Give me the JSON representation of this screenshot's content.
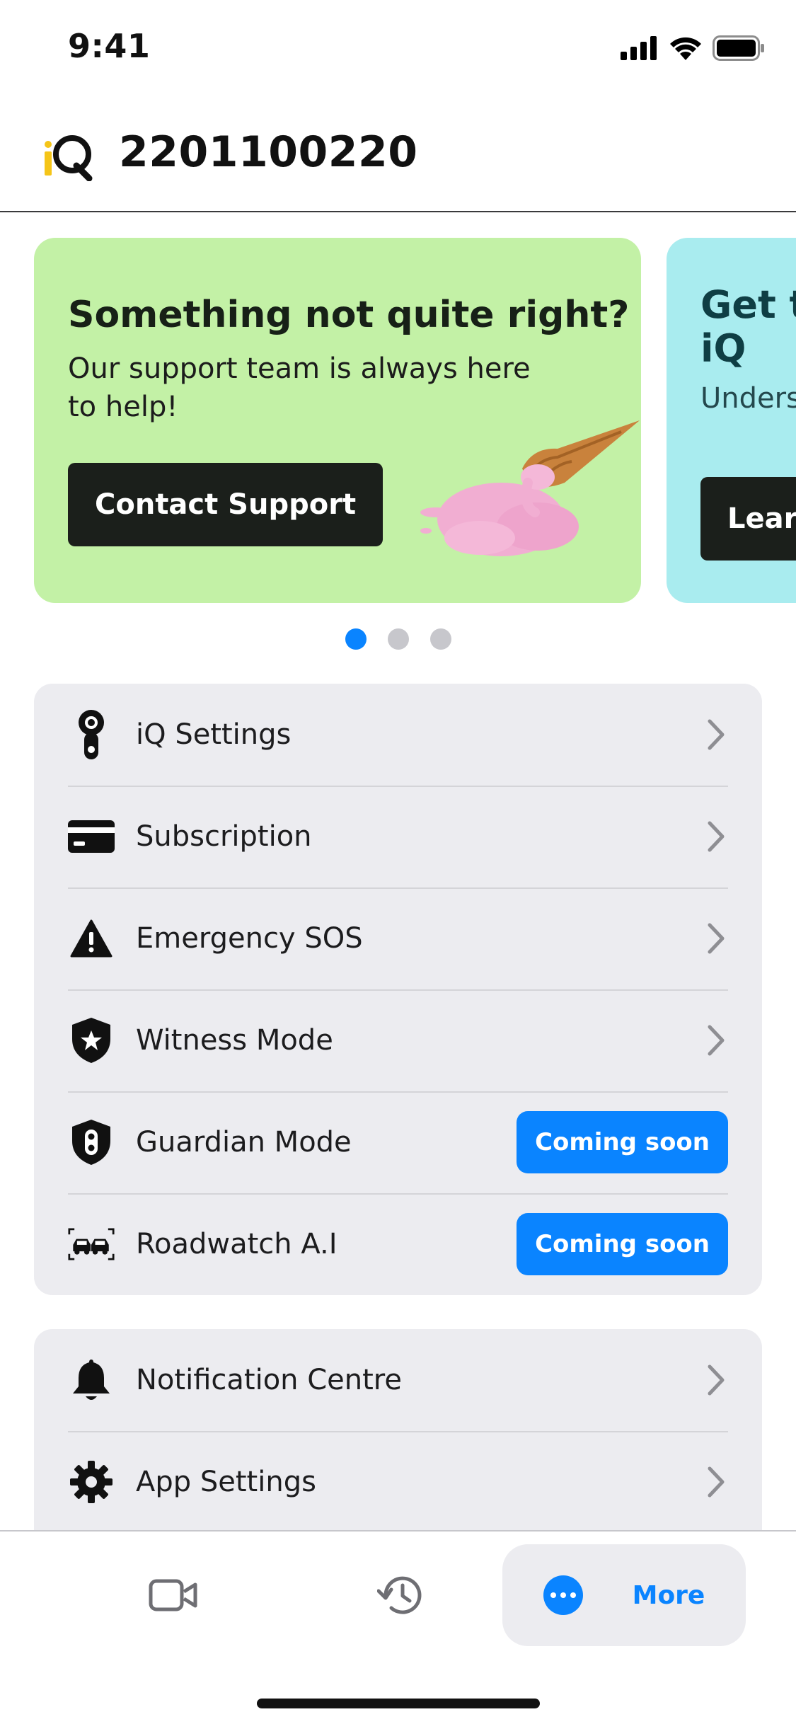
{
  "status_bar": {
    "time": "9:41"
  },
  "header": {
    "device_id": "2201100220"
  },
  "carousel": {
    "cards": [
      {
        "title": "Something not quite right?",
        "text": "Our support team is always here to help!",
        "button": "Contact Support"
      },
      {
        "title": "Get to know your iQ",
        "text": "Understand your screen",
        "button": "Learn"
      }
    ],
    "page_count": 3,
    "active_page": 1
  },
  "menu": {
    "group1": [
      {
        "label": "iQ Settings",
        "icon": "dashcam-icon",
        "action": "chevron"
      },
      {
        "label": "Subscription",
        "icon": "credit-card-icon",
        "action": "chevron"
      },
      {
        "label": "Emergency SOS",
        "icon": "warning-icon",
        "action": "chevron"
      },
      {
        "label": "Witness Mode",
        "icon": "shield-star-icon",
        "action": "chevron"
      },
      {
        "label": "Guardian Mode",
        "icon": "shield-traffic-light-icon",
        "action": "badge",
        "badge": "Coming soon"
      },
      {
        "label": "Roadwatch A.I",
        "icon": "cars-scan-icon",
        "action": "badge",
        "badge": "Coming soon"
      }
    ],
    "group2": [
      {
        "label": "Notification Centre",
        "icon": "bell-icon",
        "action": "chevron"
      },
      {
        "label": "App Settings",
        "icon": "gear-icon",
        "action": "chevron"
      }
    ]
  },
  "tab_bar": {
    "tabs": [
      {
        "name": "video",
        "icon": "video-camera-icon"
      },
      {
        "name": "history",
        "icon": "history-icon"
      },
      {
        "name": "more",
        "icon": "more-icon",
        "label": "More",
        "active": true
      }
    ]
  },
  "colors": {
    "accent": "#0a84ff",
    "support_card": "#c3f1a6",
    "learn_card": "#a9ecef",
    "logo_yellow": "#f5c518"
  }
}
